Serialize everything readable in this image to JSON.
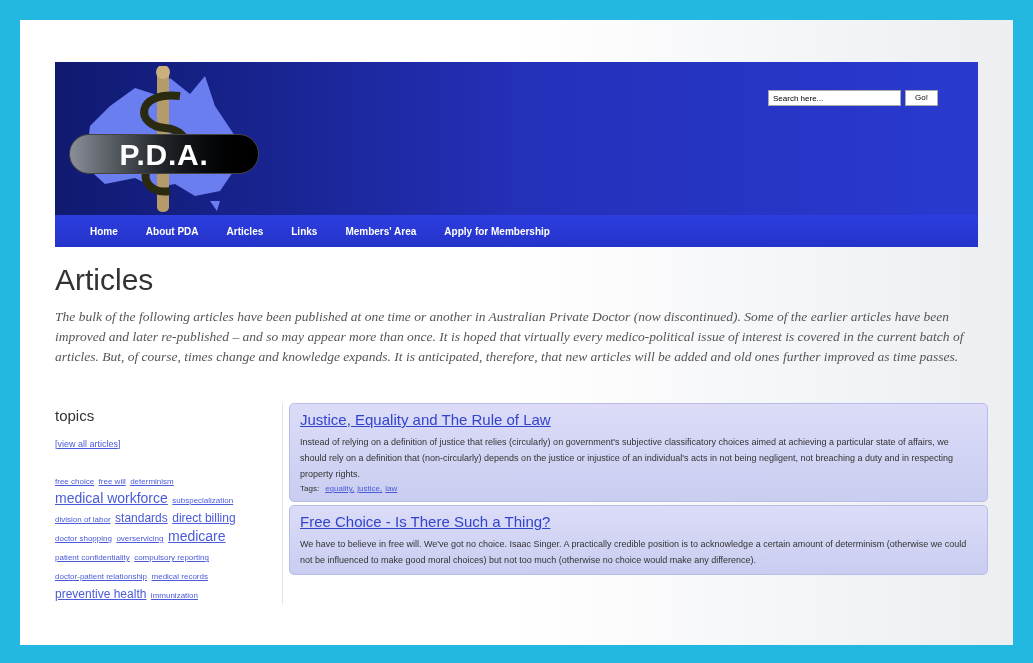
{
  "header": {
    "logo_text": "P.D.A.",
    "search": {
      "placeholder": "Search here...",
      "button": "Go!"
    }
  },
  "nav": [
    "Home",
    "About PDA",
    "Articles",
    "Links",
    "Members' Area",
    "Apply for Membership"
  ],
  "page_title": "Articles",
  "intro": "The bulk of the following articles have been published at one time or another in Australian Private Doctor (now discontinued). Some of the earlier articles have been improved and later re-published – and so may appear more than once. It is hoped that virtually every medico-political issue of interest is covered in the current batch of articles. But, of course, times change and knowledge expands. It is anticipated, therefore, that new articles will be added and old ones further improved as time passes.",
  "topics": {
    "title": "topics",
    "view_all": "[view all articles]",
    "tags": [
      {
        "label": "free choice",
        "kind": "small"
      },
      {
        "label": "free will",
        "kind": "small"
      },
      {
        "label": "determinism",
        "kind": "small"
      },
      {
        "label": "medical workforce",
        "kind": "large"
      },
      {
        "label": "subspecialization",
        "kind": "small"
      },
      {
        "label": "division of labor",
        "kind": "small"
      },
      {
        "label": "standards",
        "kind": "medium"
      },
      {
        "label": "direct billing",
        "kind": "medium"
      },
      {
        "label": "doctor shopping",
        "kind": "small"
      },
      {
        "label": "overservicing",
        "kind": "small"
      },
      {
        "label": "medicare",
        "kind": "large"
      },
      {
        "label": "patient confidentiality",
        "kind": "small"
      },
      {
        "label": "compulsory reporting",
        "kind": "small"
      },
      {
        "label": "doctor-patient relationship",
        "kind": "small"
      },
      {
        "label": "medical records",
        "kind": "small"
      },
      {
        "label": "preventive health",
        "kind": "medium"
      },
      {
        "label": "immunization",
        "kind": "small"
      }
    ]
  },
  "articles": [
    {
      "title": "Justice, Equality and The Rule of Law",
      "summary": "Instead of relying on a definition of justice that relies (circularly) on government's subjective classificatory choices aimed at achieving a particular state of affairs, we should rely on a definition that (non-circularly) depends on the justice or injustice of an individual's acts in not being negligent, not breaching a duty and in respecting property rights.",
      "tags_label": "Tags:",
      "tags": [
        "equality,",
        "justice,",
        "law"
      ]
    },
    {
      "title": "Free Choice - Is There Such a Thing?",
      "summary": "We have to believe in free will. We've got no choice. Isaac Singer. A practically credible position is to acknowledge a certain amount of determinism (otherwise we could not be influenced to make good moral choices) but not too much (otherwise no choice would make any difference)."
    }
  ]
}
